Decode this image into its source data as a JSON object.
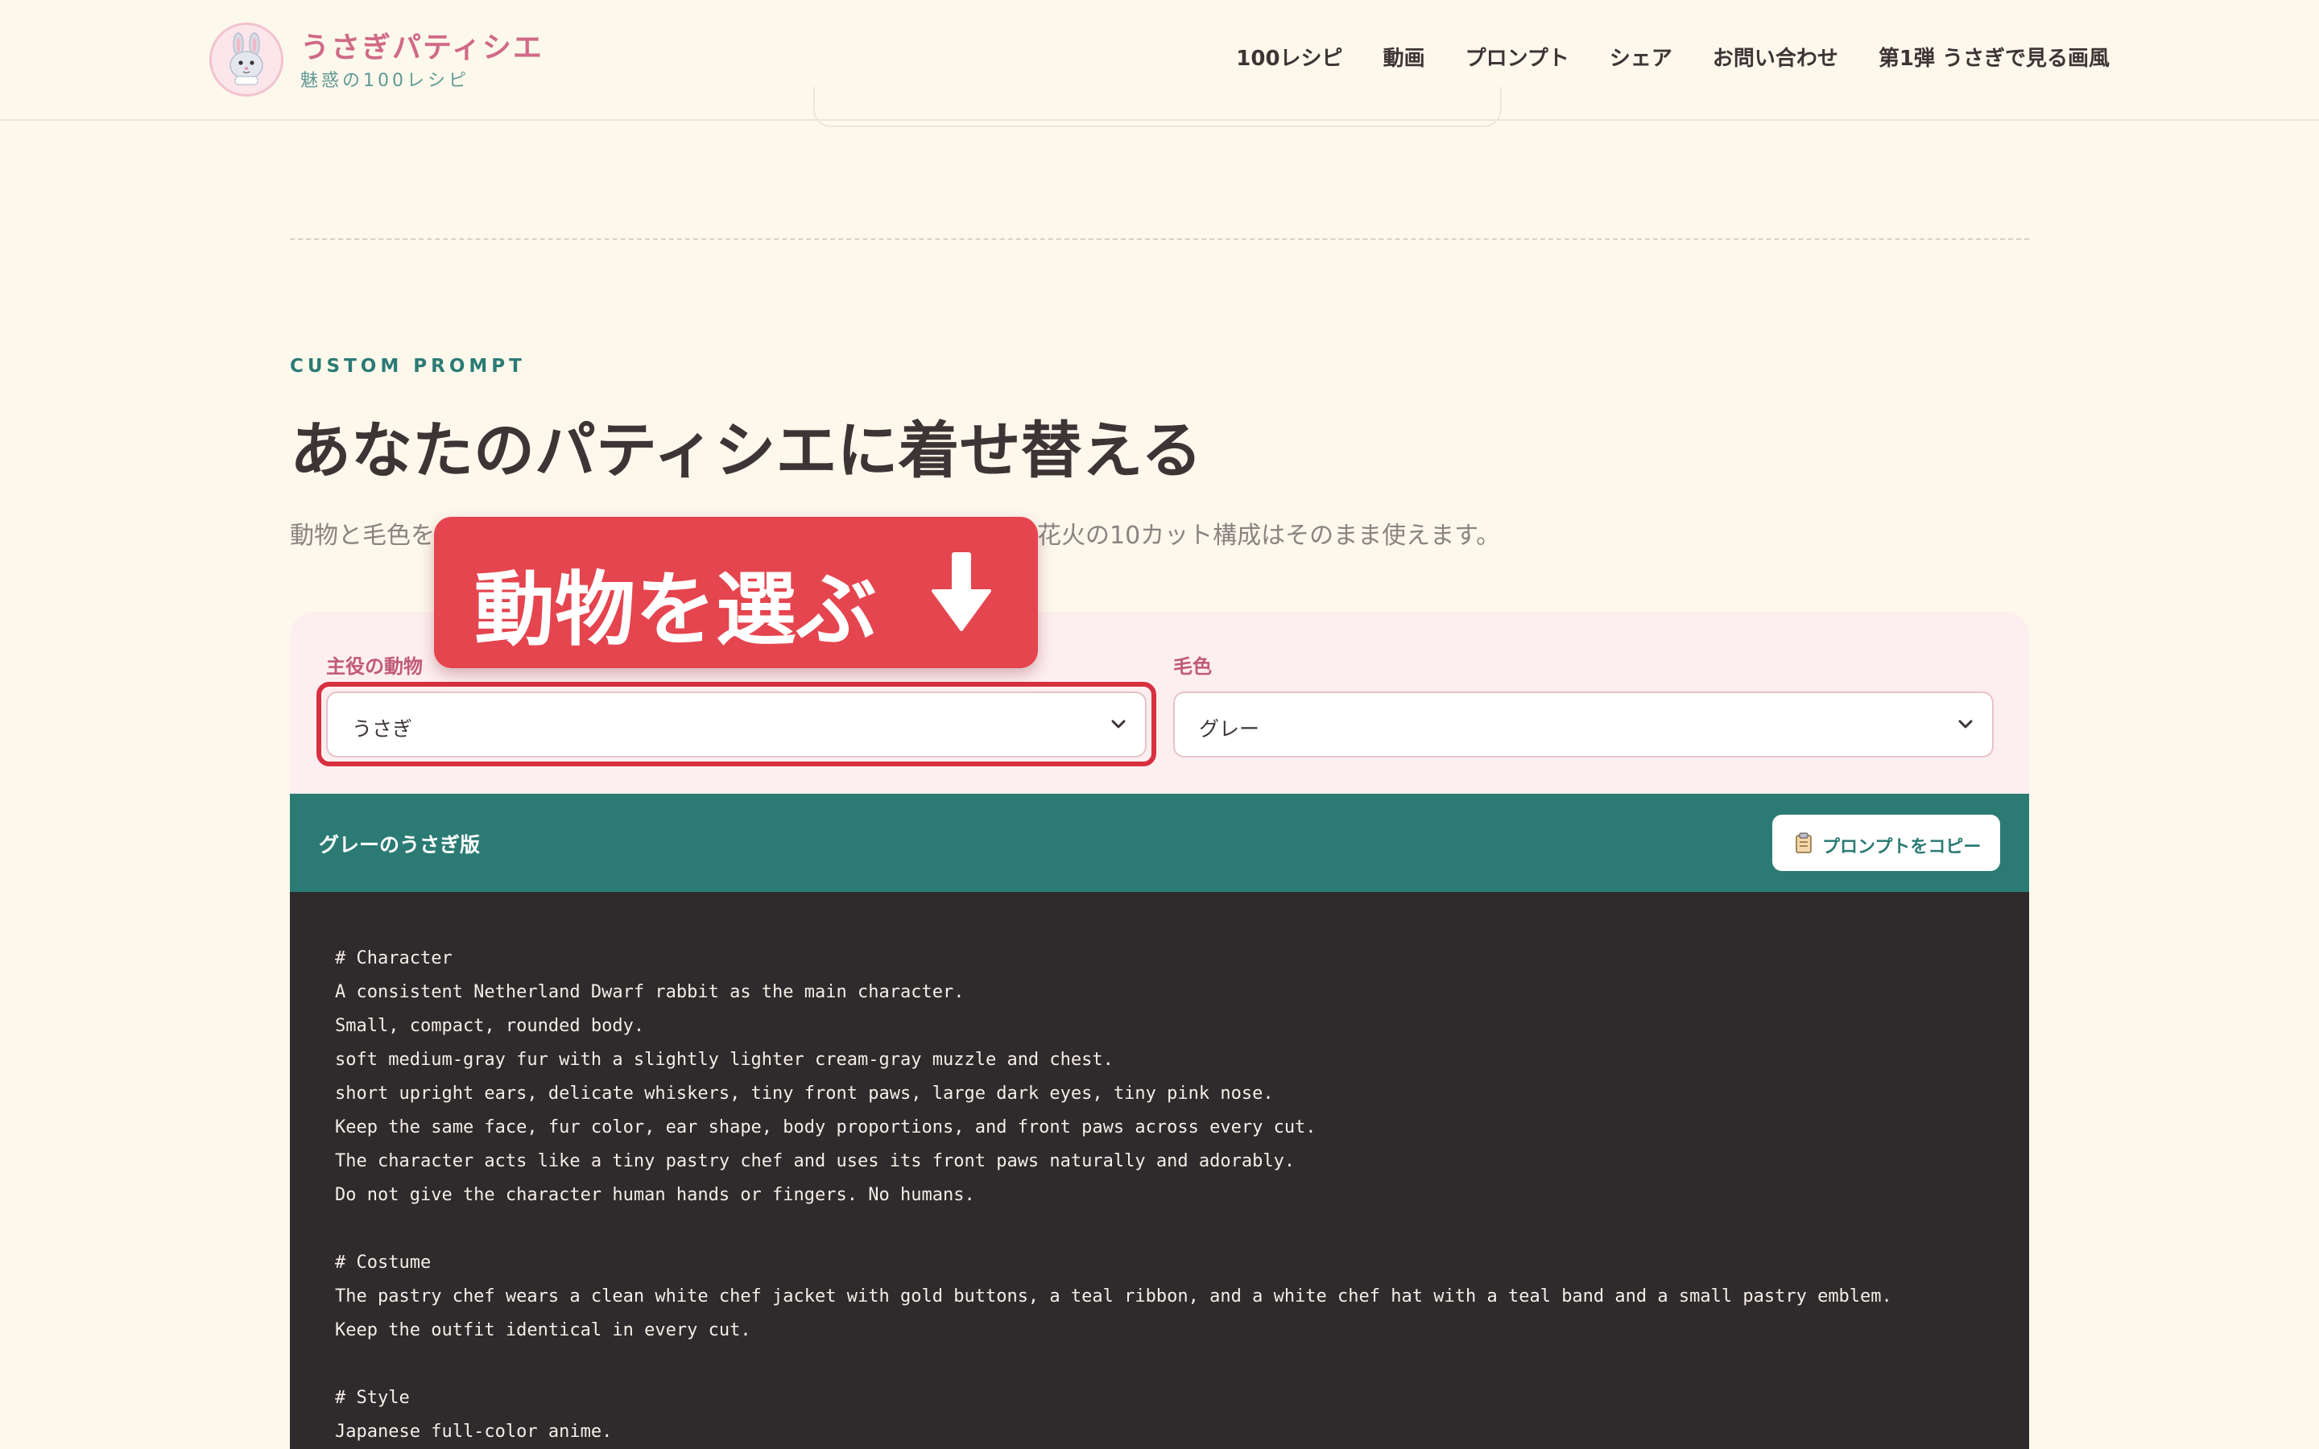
{
  "header": {
    "brand_title": "うさぎパティシエ",
    "brand_subtitle": "魅惑の100レシピ",
    "nav": [
      "100レシピ",
      "動画",
      "プロンプト",
      "シェア",
      "お問い合わせ",
      "第1弾 うさぎで見る画風"
    ]
  },
  "section": {
    "eyebrow": "CUSTOM PROMPT",
    "title": "あなたのパティシエに着せ替える",
    "lead_visible_left": "動物と毛色を",
    "lead_visible_right": "花火の10カット構成はそのまま使えます。"
  },
  "callout": {
    "text": "動物を選ぶ",
    "icon": "arrow-down-icon",
    "color": "#e5454f"
  },
  "selector": {
    "animal_label": "主役の動物",
    "animal_value": "うさぎ",
    "color_label": "毛色",
    "color_value": "グレー"
  },
  "result": {
    "title": "グレーのうさぎ版",
    "copy_button_label": "プロンプトをコピー",
    "copy_icon": "clipboard-icon"
  },
  "prompt_lines": [
    "# Character",
    "A consistent Netherland Dwarf rabbit as the main character.",
    "Small, compact, rounded body.",
    "soft medium-gray fur with a slightly lighter cream-gray muzzle and chest.",
    "short upright ears, delicate whiskers, tiny front paws, large dark eyes, tiny pink nose.",
    "Keep the same face, fur color, ear shape, body proportions, and front paws across every cut.",
    "The character acts like a tiny pastry chef and uses its front paws naturally and adorably.",
    "Do not give the character human hands or fingers. No humans.",
    "",
    "# Costume",
    "The pastry chef wears a clean white chef jacket with gold buttons, a teal ribbon, and a white chef hat with a teal band and a small pastry emblem.",
    "Keep the outfit identical in every cut.",
    "",
    "# Style",
    "Japanese full-color anime."
  ],
  "colors": {
    "background": "#fdf8ec",
    "accent_pink": "#d06a86",
    "teal": "#2b7b74",
    "code_bg": "#2f2a2b",
    "highlight_red": "#d8303f"
  }
}
